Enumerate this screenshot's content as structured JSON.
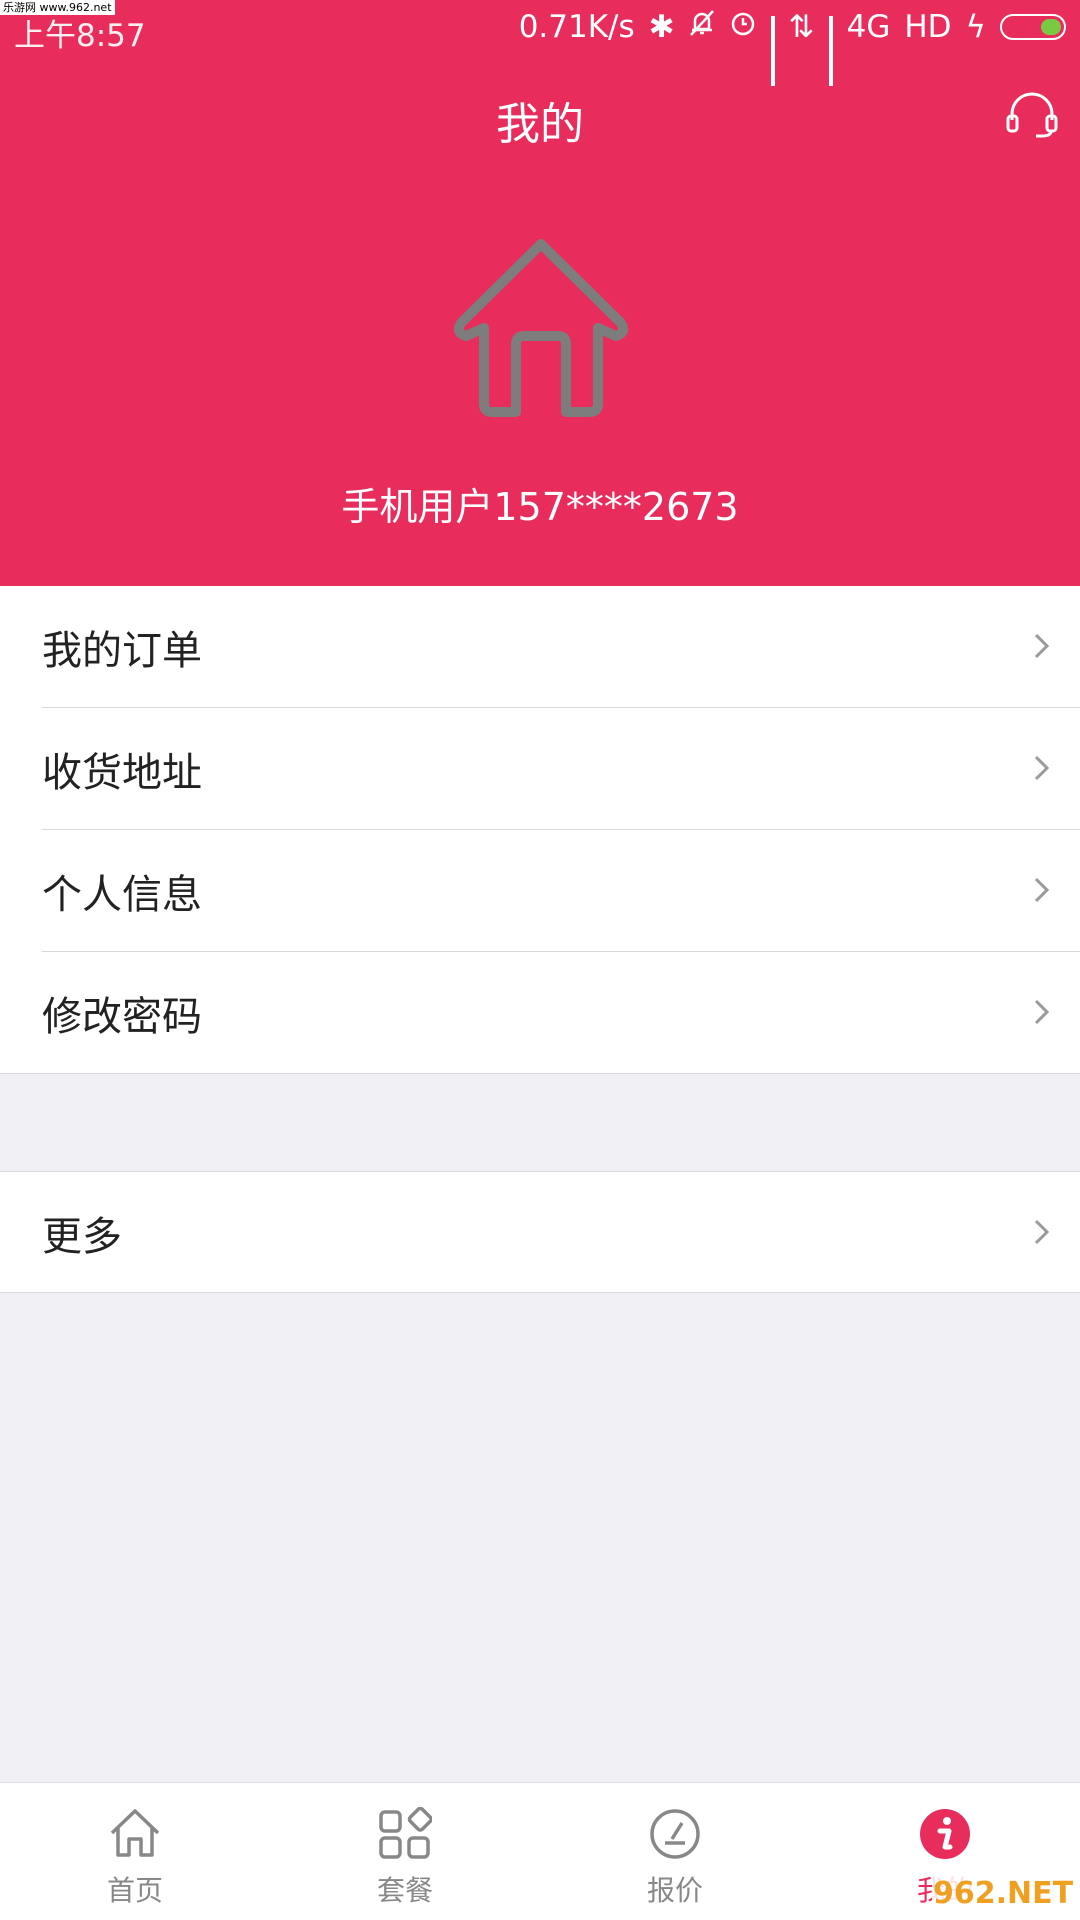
{
  "status_bar": {
    "time": "上午8:57",
    "network_speed": "0.71K/s",
    "network_type": "4G",
    "hd": "HD",
    "watermark": "乐游网 www.962.net"
  },
  "header": {
    "title": "我的",
    "user_name": "手机用户157****2673",
    "background_color": "#e82c5c"
  },
  "menu": {
    "items": [
      {
        "label": "我的订单"
      },
      {
        "label": "收货地址"
      },
      {
        "label": "个人信息"
      },
      {
        "label": "修改密码"
      }
    ],
    "more": {
      "label": "更多"
    }
  },
  "tabbar": {
    "tabs": [
      {
        "label": "首页",
        "icon": "home-icon"
      },
      {
        "label": "套餐",
        "icon": "grid-icon"
      },
      {
        "label": "报价",
        "icon": "edit-icon"
      },
      {
        "label": "我的",
        "icon": "info-icon"
      }
    ],
    "active_color": "#e82c5c",
    "watermark": "962.NET"
  }
}
